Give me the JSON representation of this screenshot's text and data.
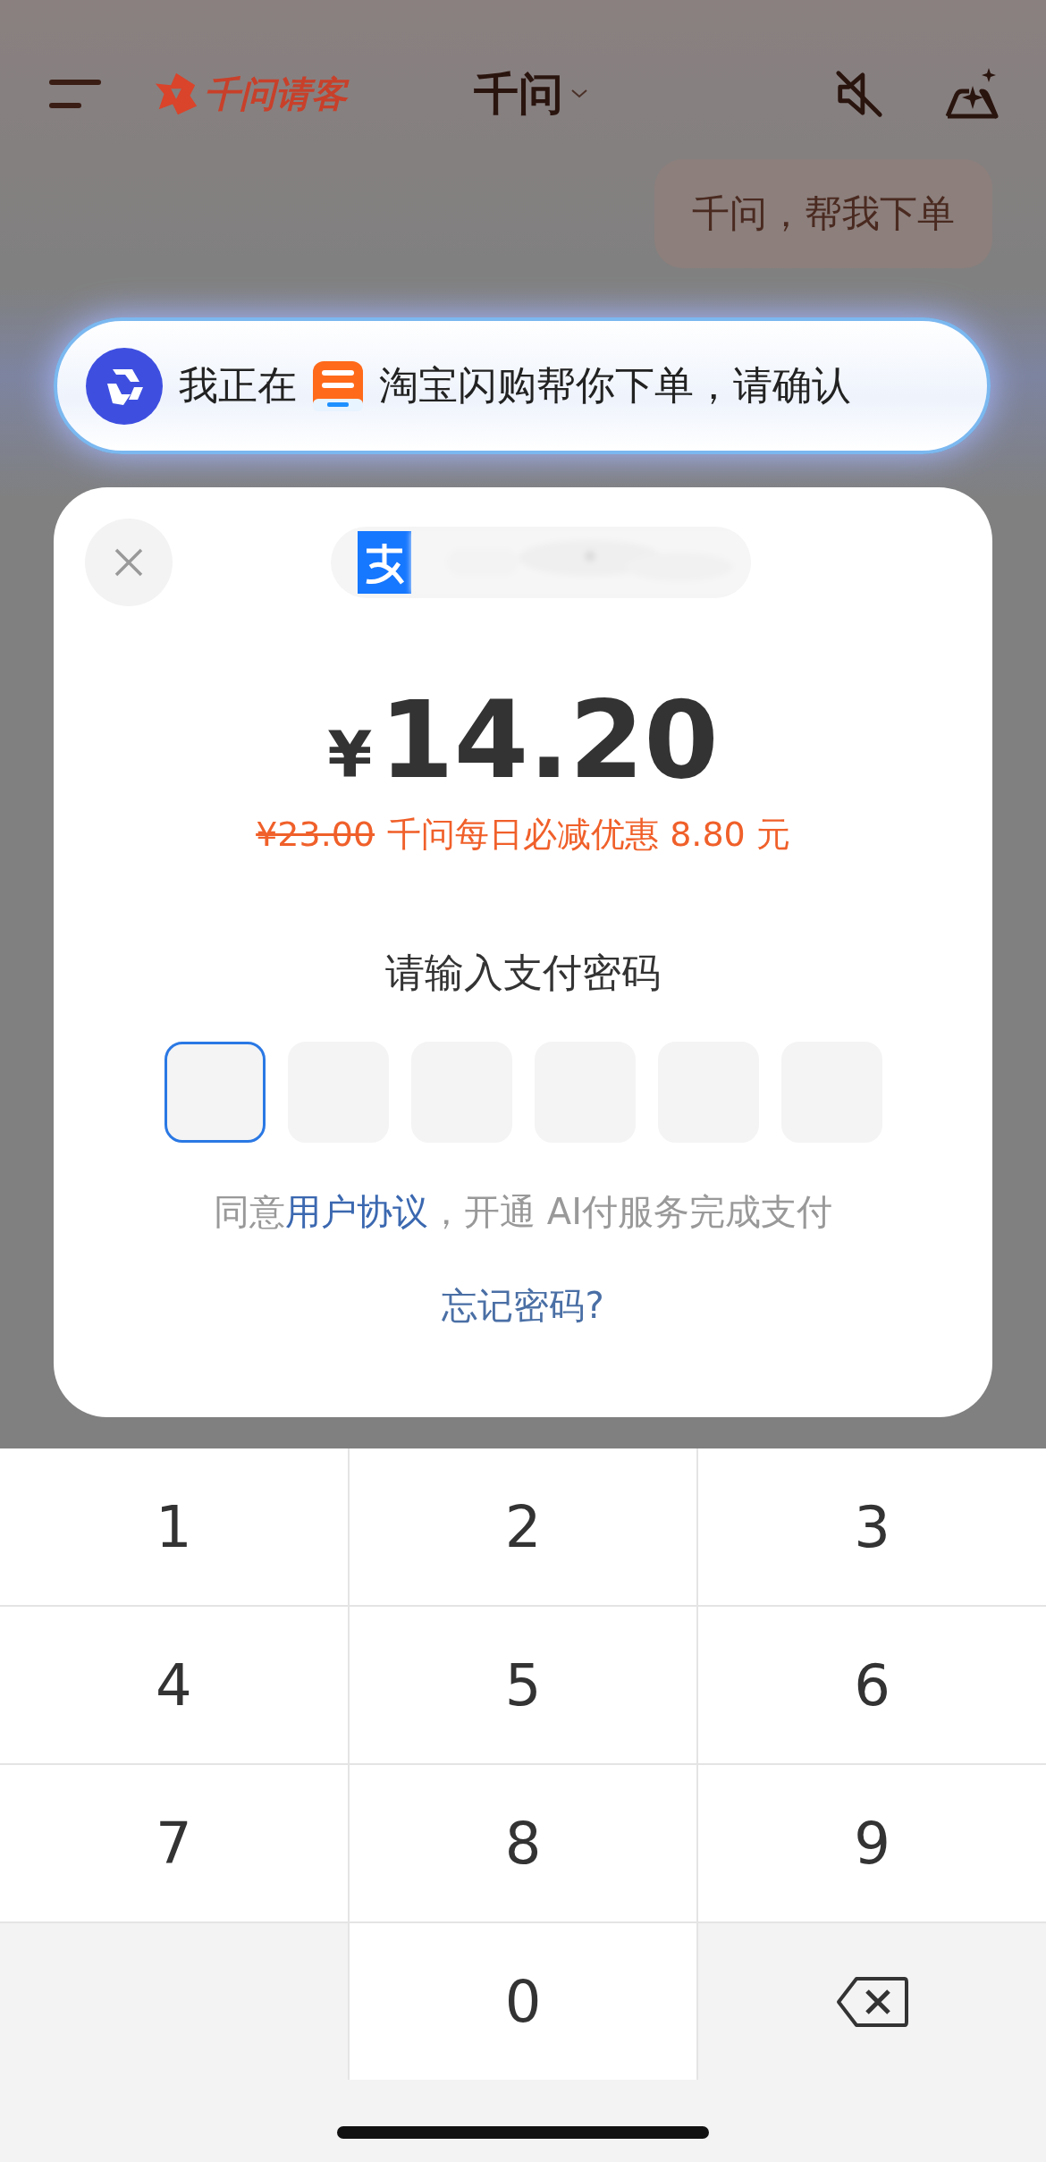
{
  "top_bar": {
    "brand": "千问请客",
    "title": "千问"
  },
  "user_message": "千问，帮我下单",
  "status_banner": {
    "before": "我正在",
    "after": "淘宝闪购帮你下单，请确认"
  },
  "payment": {
    "currency": "¥",
    "amount": "14.20",
    "original_price": "¥23.00",
    "discount": "千问每日必减优惠 8.80 元",
    "prompt": "请输入支付密码",
    "pin_boxes": [
      {
        "selected": true
      },
      {
        "selected": false
      },
      {
        "selected": false
      },
      {
        "selected": false
      },
      {
        "selected": false
      },
      {
        "selected": false
      }
    ],
    "agreement_before": "同意",
    "agreement_link": "用户协议",
    "agreement_after": "，开通 AI付服务完成支付",
    "forgot_password": "忘记密码?"
  },
  "keypad": [
    {
      "kind": "digit",
      "label": "1"
    },
    {
      "kind": "digit",
      "label": "2"
    },
    {
      "kind": "digit",
      "label": "3"
    },
    {
      "kind": "digit",
      "label": "4"
    },
    {
      "kind": "digit",
      "label": "5"
    },
    {
      "kind": "digit",
      "label": "6"
    },
    {
      "kind": "digit",
      "label": "7"
    },
    {
      "kind": "digit",
      "label": "8"
    },
    {
      "kind": "digit",
      "label": "9"
    },
    {
      "kind": "blank"
    },
    {
      "kind": "digit",
      "label": "0"
    },
    {
      "kind": "backspace"
    }
  ]
}
